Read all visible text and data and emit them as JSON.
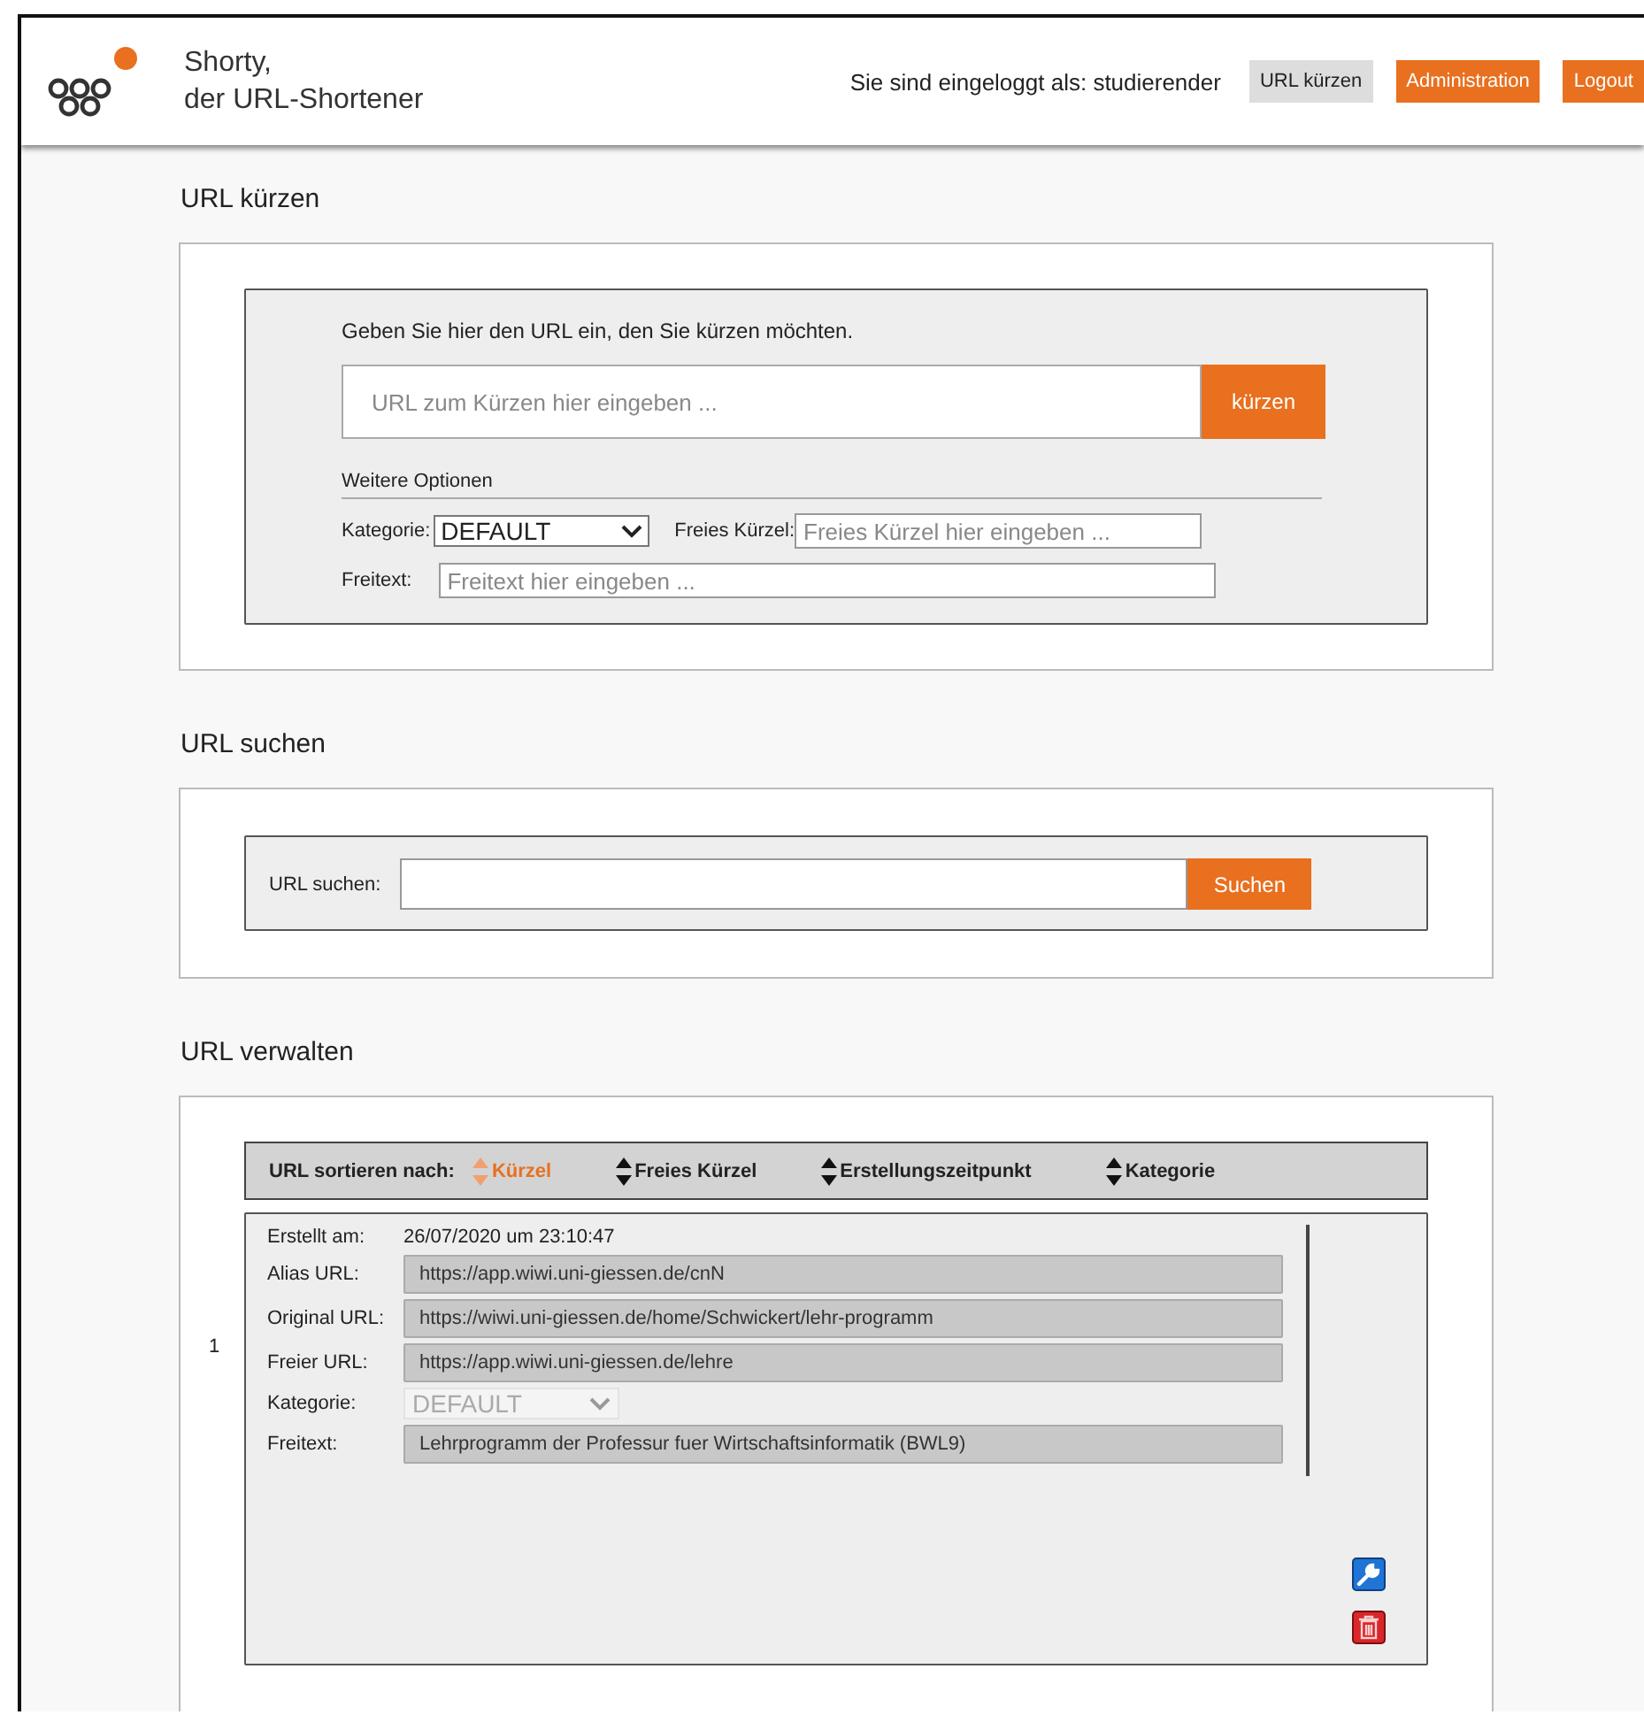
{
  "header": {
    "title_lines": [
      "Shorty,",
      "der URL-Shortener"
    ],
    "login_text": "Sie sind eingeloggt als: studierender",
    "nav": [
      {
        "label": "URL kürzen",
        "selected": true
      },
      {
        "label": "Administration",
        "selected": false
      },
      {
        "label": "Logout",
        "selected": false
      }
    ]
  },
  "sections": [
    {
      "kind": "shorten",
      "title": "URL kürzen",
      "intro": "Geben Sie hier den URL ein, den Sie kürzen möchten.",
      "url_placeholder": "URL zum Kürzen hier eingeben ...",
      "submit": "kürzen",
      "options_title": "Weitere Optionen",
      "category_label": "Kategorie:",
      "category_value": "DEFAULT",
      "alias_label": "Freies Kürzel:",
      "alias_placeholder": "Freies Kürzel hier eingeben ...",
      "freetext_label": "Freitext:",
      "freetext_placeholder": "Freitext hier eingeben ..."
    },
    {
      "kind": "search",
      "title": "URL suchen",
      "label": "URL suchen:",
      "button": "Suchen"
    },
    {
      "kind": "manage",
      "title": "URL verwalten",
      "sort_label": "URL sortieren nach:",
      "sort_options": [
        {
          "label": "Kürzel",
          "selected": true
        },
        {
          "label": "Freies Kürzel",
          "selected": false
        },
        {
          "label": "Erstellungszeitpunkt",
          "selected": false
        },
        {
          "label": "Kategorie",
          "selected": false
        }
      ],
      "entries": [
        {
          "number": "1",
          "fields": [
            {
              "kind": "text",
              "label": "Erstellt am:",
              "value": "26/07/2020 um 23:10:47"
            },
            {
              "kind": "field",
              "label": "Alias URL:",
              "value": "https://app.wiwi.uni-giessen.de/cnN",
              "disabled": false
            },
            {
              "kind": "field",
              "label": "Original URL:",
              "value": "https://wiwi.uni-giessen.de/home/Schwickert/lehr-programm",
              "disabled": false
            },
            {
              "kind": "field",
              "label": "Freier URL:",
              "value": "https://app.wiwi.uni-giessen.de/lehre",
              "disabled": false
            },
            {
              "kind": "select",
              "label": "Kategorie:",
              "value": "DEFAULT",
              "disabled": true
            },
            {
              "kind": "field",
              "label": "Freitext:",
              "value": "Lehrprogramm der Professur fuer Wirtschaftsinformatik (BWL9)",
              "disabled": false
            }
          ]
        }
      ]
    }
  ]
}
